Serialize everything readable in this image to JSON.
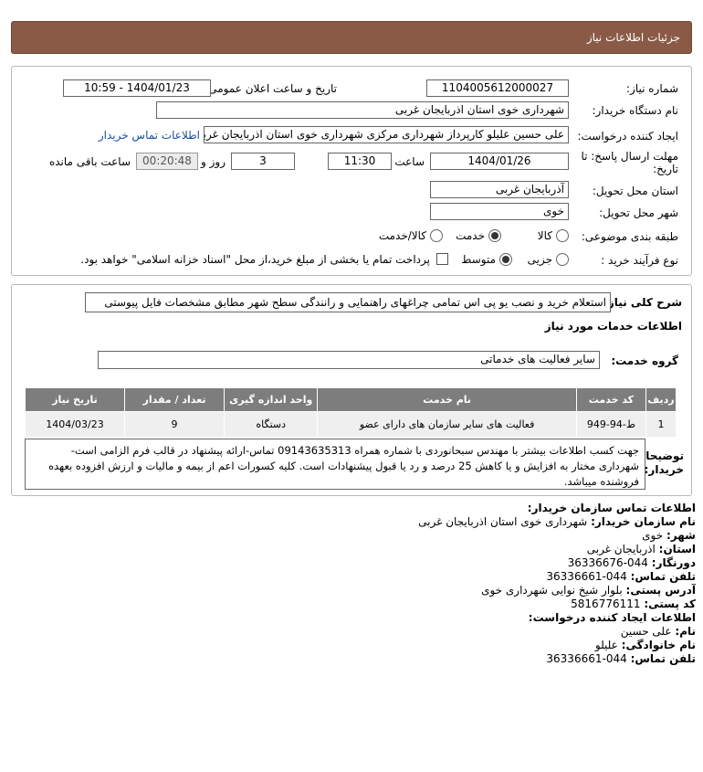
{
  "page": {
    "title": "جزئیات اطلاعات نیاز"
  },
  "details": {
    "need_number_label": "شماره نیاز:",
    "need_number": "1104005612000027",
    "announce_label": "تاریخ و ساعت اعلان عمومی:",
    "announce_value": "1404/01/23 - 10:59",
    "buyer_org_label": "نام دستگاه خریدار:",
    "buyer_org": "شهرداری خوی استان اذربایجان غربی",
    "creator_label": "ایجاد کننده درخواست:",
    "creator": "علی حسین علیلو کارپرداز شهرداری مرکزی شهرداری خوی استان اذربایجان غربی",
    "buyer_contact_link": "اطلاعات تماس خریدار",
    "deadline_label": "مهلت ارسال پاسخ: تا تاریخ:",
    "deadline_date": "1404/01/26",
    "time_label": "ساعت",
    "deadline_time": "11:30",
    "days_value": "3",
    "days_label": "روز و",
    "remaining_time": "00:20:48",
    "remaining_label": "ساعت باقی مانده",
    "province_label": "استان محل تحویل:",
    "province": "آذربایجان غربی",
    "city_label": "شهر محل تحویل:",
    "city": "خوی",
    "category_label": "طبقه بندی موضوعی:",
    "category_options": [
      "کالا",
      "خدمت",
      "کالا/خدمت"
    ],
    "category_selected": "خدمت",
    "process_label": "نوع فرآیند خرید :",
    "process_options": [
      "جزیی",
      "متوسط"
    ],
    "process_selected": "متوسط",
    "treasury_note": "پرداخت تمام یا بخشی از مبلغ خرید،از محل \"اسناد خزانه اسلامی\" خواهد بود."
  },
  "overview": {
    "label": "شرح کلی نیاز:",
    "value": "استعلام خرید و نصب یو پی اس تمامی چراغهای راهنمایی و رانندگی سطح شهر مطابق مشخصات فایل پیوستی"
  },
  "services": {
    "section_title": "اطلاعات خدمات مورد نیاز",
    "group_label": "گروه خدمت:",
    "group_value": "سایر فعالیت های خدماتی",
    "columns": [
      "ردیف",
      "کد خدمت",
      "نام خدمت",
      "واحد اندازه گیری",
      "تعداد / مقدار",
      "تاریخ نیاز"
    ],
    "rows": [
      {
        "row": "1",
        "code": "ط-94-949",
        "name": "فعالیت های سایر سازمان های دارای عضو",
        "unit": "دستگاه",
        "qty": "9",
        "date": "1404/03/23"
      }
    ]
  },
  "buyer_notes": {
    "label": "توضیحات خریدار:",
    "value": "جهت کسب اطلاعات بیشتر با مهندس سبحانوردی با شماره همراه 09143635313 تماس-ارائه پیشنهاد در قالب فرم الزامی است-شهرداری مختار به افزایش و یا کاهش 25 درصد و رد یا قبول پیشنهادات است. کلیه کسورات اعم از بیمه و مالیات و ارزش افزوده بعهده فروشنده میباشد."
  },
  "contact": {
    "buyer_title": "اطلاعات تماس سازمان خریدار:",
    "org_label": "نام سازمان خریدار:",
    "org_value": "شهرداری خوی استان اذربایجان غربی",
    "city_label": "شهر:",
    "city_value": "خوی",
    "province_label": "استان:",
    "province_value": "اذربایجان غربی",
    "fax_label": "دورنگار:",
    "fax_value": "044-36336676",
    "phone_label": "تلفن تماس:",
    "phone_value": "044-36336661",
    "address_label": "آدرس پستی:",
    "address_value": "بلوار شیخ نوایی شهرداری خوی",
    "postal_label": "کد پستی:",
    "postal_value": "5816776111",
    "creator_title": "اطلاعات ایجاد کننده درخواست:",
    "name_label": "نام:",
    "name_value": "علی حسین",
    "family_label": "نام خانوادگی:",
    "family_value": "علیلو",
    "creator_phone_label": "تلفن تماس:",
    "creator_phone_value": "044-36336661"
  },
  "colors": {
    "header_bg": "#8a5a47",
    "table_header_bg": "#7d7d7d",
    "link": "#1a4fa0"
  }
}
